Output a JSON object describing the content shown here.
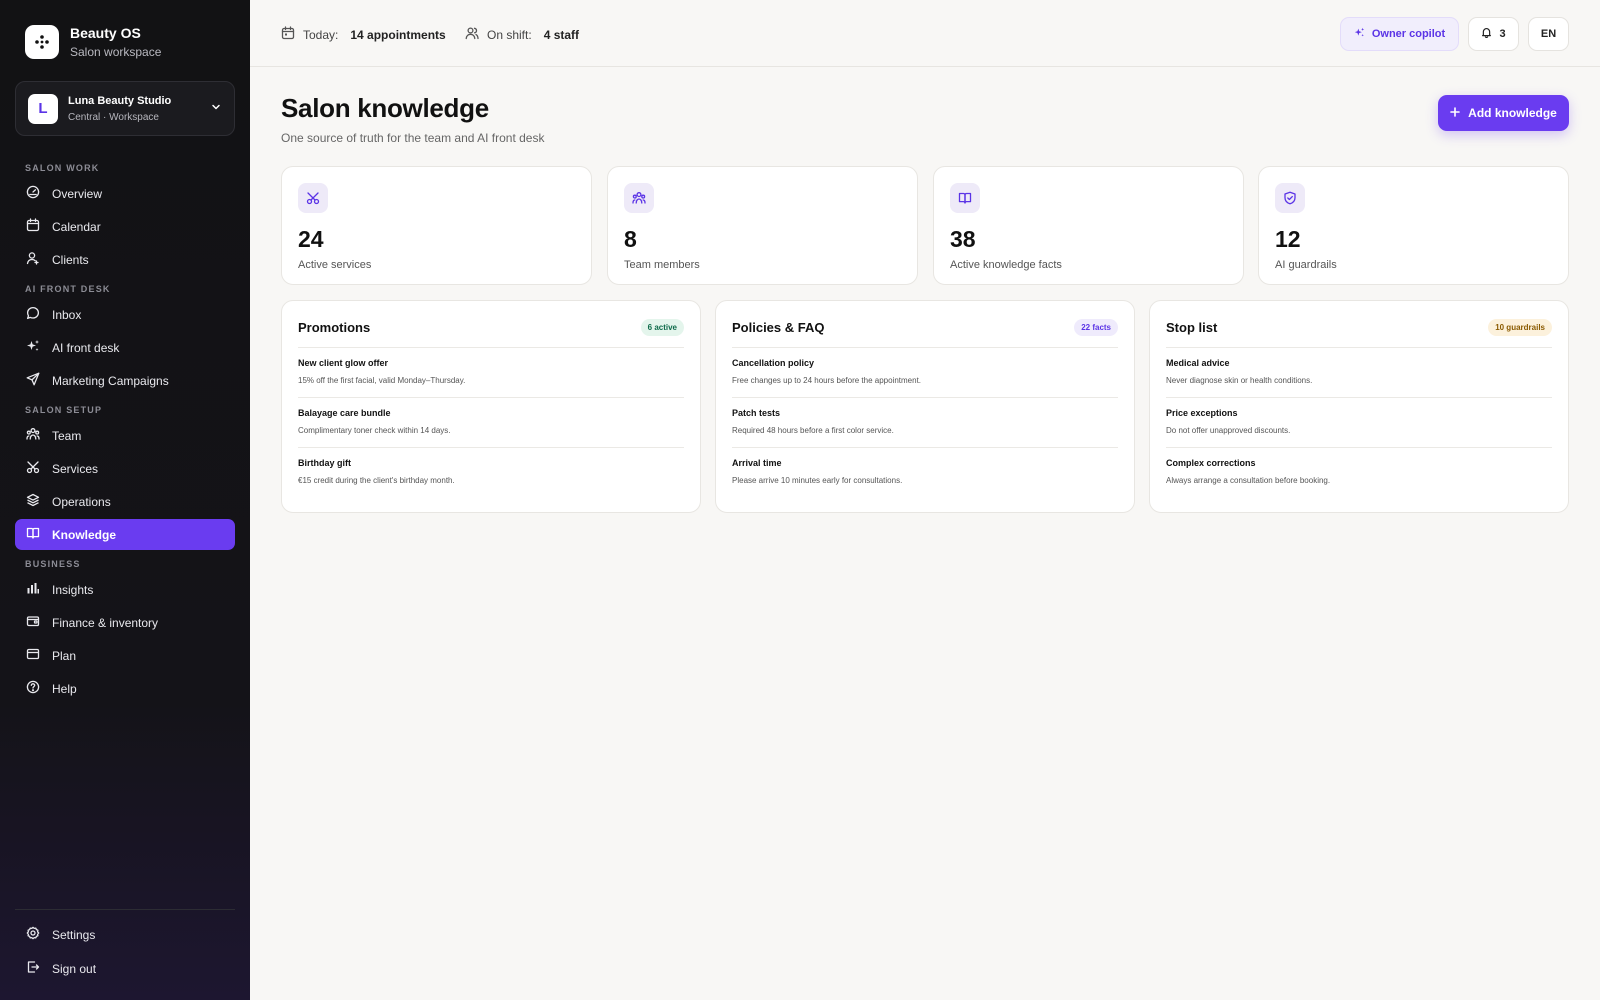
{
  "brand": {
    "name": "Beauty OS",
    "subtitle": "Salon workspace"
  },
  "workspace": {
    "initial": "L",
    "name": "Luna Beauty Studio",
    "subtitle": "Central · Workspace"
  },
  "nav": {
    "sections": [
      "SALON WORK",
      "AI FRONT DESK",
      "SALON SETUP",
      "BUSINESS"
    ],
    "items": [
      {
        "label": "Overview",
        "icon": "gauge-icon"
      },
      {
        "label": "Calendar",
        "icon": "calendar-icon"
      },
      {
        "label": "Clients",
        "icon": "user-icon"
      },
      {
        "label": "Inbox",
        "icon": "chat-icon"
      },
      {
        "label": "AI front desk",
        "icon": "sparkles-icon"
      },
      {
        "label": "Marketing Campaigns",
        "icon": "send-icon"
      },
      {
        "label": "Team",
        "icon": "team-icon"
      },
      {
        "label": "Services",
        "icon": "scissors-icon"
      },
      {
        "label": "Operations",
        "icon": "layers-icon"
      },
      {
        "label": "Knowledge",
        "icon": "book-icon",
        "active": true
      },
      {
        "label": "Insights",
        "icon": "bar-chart-icon"
      },
      {
        "label": "Finance & inventory",
        "icon": "wallet-icon"
      },
      {
        "label": "Plan",
        "icon": "card-icon"
      },
      {
        "label": "Help",
        "icon": "help-icon"
      }
    ],
    "footer": [
      {
        "label": "Settings",
        "icon": "gear-icon"
      },
      {
        "label": "Sign out",
        "icon": "logout-icon"
      }
    ]
  },
  "topbar": {
    "today_label": "Today:",
    "today_value": "14 appointments",
    "shift_label": "On shift:",
    "shift_value": "4 staff",
    "copilot_label": "Owner copilot",
    "notifications_count": "3",
    "language": "EN"
  },
  "page": {
    "title": "Salon knowledge",
    "subtitle": "One source of truth for the team and AI front desk",
    "add_button": "Add knowledge"
  },
  "stats": [
    {
      "value": "24",
      "label": "Active services",
      "icon": "scissors-icon"
    },
    {
      "value": "8",
      "label": "Team members",
      "icon": "team-icon"
    },
    {
      "value": "38",
      "label": "Active knowledge facts",
      "icon": "book-icon"
    },
    {
      "value": "12",
      "label": "AI guardrails",
      "icon": "shield-check-icon"
    }
  ],
  "lists": [
    {
      "title": "Promotions",
      "badge": "6 active",
      "badge_color": "#0f6b4a",
      "badge_bg": "#e4f5ec",
      "rows": [
        {
          "title": "New client glow offer",
          "desc": "15% off the first facial, valid Monday–Thursday."
        },
        {
          "title": "Balayage care bundle",
          "desc": "Complimentary toner check within 14 days."
        },
        {
          "title": "Birthday gift",
          "desc": "€15 credit during the client's birthday month."
        }
      ]
    },
    {
      "title": "Policies & FAQ",
      "badge": "22 facts",
      "badge_color": "#5b34e6",
      "badge_bg": "#efebfc",
      "rows": [
        {
          "title": "Cancellation policy",
          "desc": "Free changes up to 24 hours before the appointment."
        },
        {
          "title": "Patch tests",
          "desc": "Required 48 hours before a first color service."
        },
        {
          "title": "Arrival time",
          "desc": "Please arrive 10 minutes early for consultations."
        }
      ]
    },
    {
      "title": "Stop list",
      "badge": "10 guardrails",
      "badge_color": "#8a5a00",
      "badge_bg": "#fcf1dc",
      "rows": [
        {
          "title": "Medical advice",
          "desc": "Never diagnose skin or health conditions."
        },
        {
          "title": "Price exceptions",
          "desc": "Do not offer unapproved discounts."
        },
        {
          "title": "Complex corrections",
          "desc": "Always arrange a consultation before booking."
        }
      ]
    }
  ],
  "colors": {
    "accent": "#6a3cf0",
    "sidebar_bg": "#121214",
    "page_bg": "#f8f7f5"
  }
}
